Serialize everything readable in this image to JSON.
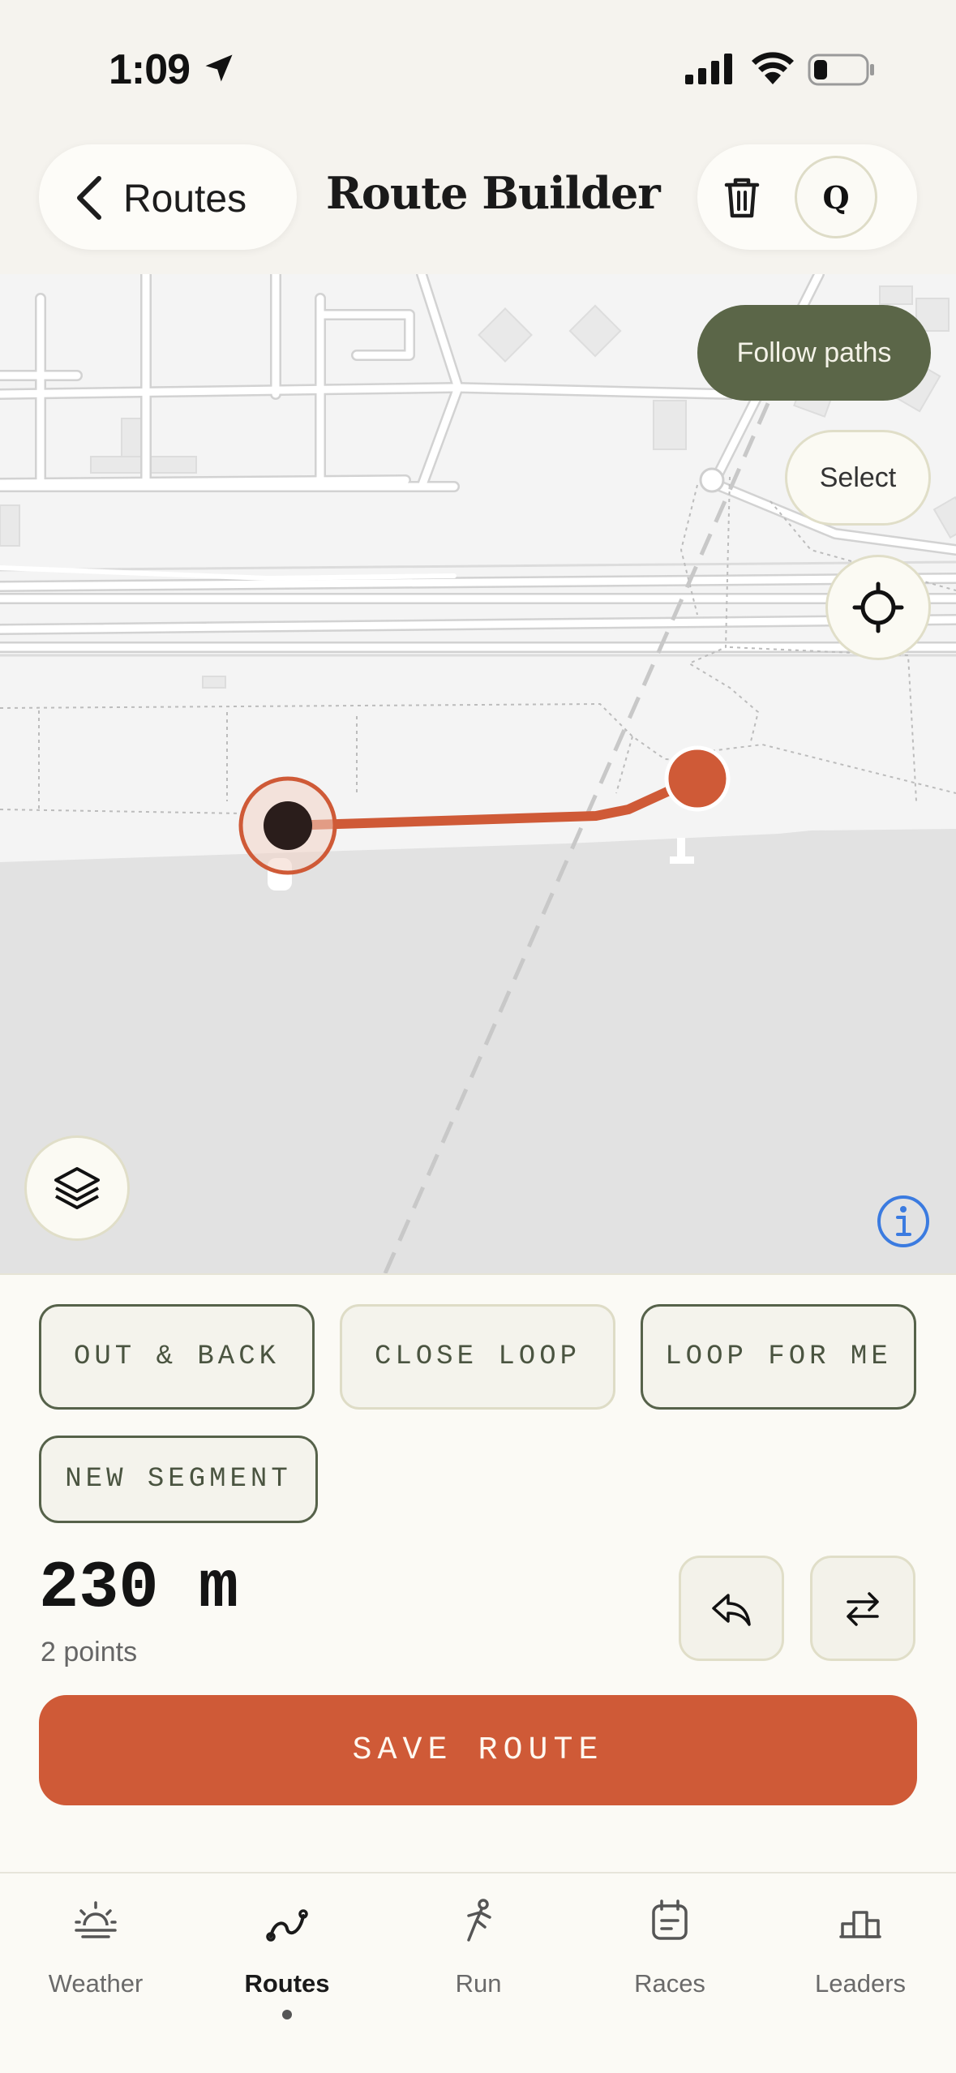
{
  "status_bar": {
    "time": "1:09"
  },
  "header": {
    "back_label": "Routes",
    "title": "Route Builder",
    "q_label": "Q"
  },
  "map": {
    "follow_paths_label": "Follow paths",
    "select_label": "Select",
    "route_color": "#cf5a37"
  },
  "route_options": {
    "out_and_back": "OUT & BACK",
    "close_loop": "CLOSE LOOP",
    "loop_for_me": "LOOP FOR ME",
    "new_segment": "NEW SEGMENT"
  },
  "summary": {
    "distance": "230 m",
    "points": "2 points"
  },
  "save_label": "SAVE ROUTE",
  "tabs": [
    {
      "label": "Weather",
      "icon": "sunrise-icon"
    },
    {
      "label": "Routes",
      "icon": "route-icon",
      "active": true
    },
    {
      "label": "Run",
      "icon": "runner-icon"
    },
    {
      "label": "Races",
      "icon": "calendar-icon"
    },
    {
      "label": "Leaders",
      "icon": "podium-icon"
    }
  ],
  "colors": {
    "accent": "#cf5a37",
    "olive": "#5b6648",
    "background": "#fbfaf5"
  }
}
